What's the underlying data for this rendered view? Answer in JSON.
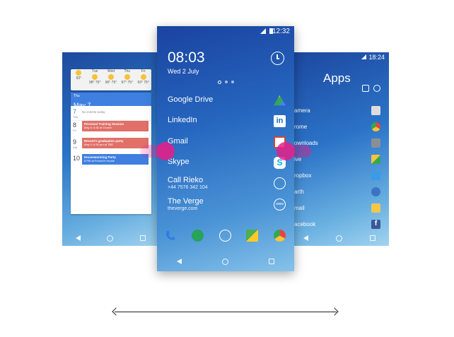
{
  "left_phone": {
    "status_time": "",
    "weather": [
      {
        "day": "",
        "temp": "93°"
      },
      {
        "day": "Tue",
        "temp": "98° 75°"
      },
      {
        "day": "Wed",
        "temp": "96° 75°"
      },
      {
        "day": "Thu",
        "temp": "97° 75°"
      },
      {
        "day": "Fri",
        "temp": "93° 75°"
      }
    ],
    "calendar": {
      "weekday": "Thu",
      "date": "May 7",
      "rows": [
        {
          "num": "7",
          "dow": "Thu",
          "note": "No events today"
        },
        {
          "num": "8",
          "dow": "Fri"
        },
        {
          "num": "9",
          "dow": "Sat"
        },
        {
          "num": "10",
          "dow": ""
        }
      ],
      "events": [
        {
          "title": "Personal Training Session",
          "detail": "May 8, 6:30 at Crunch",
          "color": "#e07068"
        },
        {
          "title": "Recent's graduation party",
          "detail": "May 9, 6:30 pm at TBD",
          "color": "#e07068"
        },
        {
          "title": "Housewarming Party",
          "detail": "8 PM at Freund's House",
          "color": "#3f7fe0"
        }
      ]
    }
  },
  "center_phone": {
    "status_time": "12:32",
    "clock": "08:03",
    "date": "Wed 2 July",
    "items": [
      {
        "title": "Google Drive",
        "sub": "",
        "icon": "google-drive-icon"
      },
      {
        "title": "LinkedIn",
        "sub": "",
        "icon": "linkedin-icon",
        "glyph": "in"
      },
      {
        "title": "Gmail",
        "sub": "",
        "icon": "gmail-icon"
      },
      {
        "title": "Skype",
        "sub": "",
        "icon": "skype-icon",
        "glyph": "S"
      },
      {
        "title": "Call Rieko",
        "sub": "+44 7576 342 104",
        "icon": "contact-icon"
      },
      {
        "title": "The Verge",
        "sub": "theverge.com",
        "icon": "www-icon",
        "glyph": "www"
      }
    ],
    "dock": [
      "phone-icon",
      "hangouts-icon",
      "app-drawer-icon",
      "maps-icon",
      "chrome-icon"
    ]
  },
  "right_phone": {
    "status_time": "18:24",
    "title": "Apps",
    "apps": [
      {
        "label": "amera",
        "icon": "camera-icon",
        "color": "#dddddd"
      },
      {
        "label": "rome",
        "icon": "chrome-icon",
        "color": "#e8453c"
      },
      {
        "label": "ownloads",
        "icon": "downloads-icon",
        "color": "#8a8f96"
      },
      {
        "label": "ive",
        "icon": "drive-icon",
        "color": "#f7c43c"
      },
      {
        "label": "ropbox",
        "icon": "dropbox-icon",
        "color": "#3d9ae8"
      },
      {
        "label": "arth",
        "icon": "earth-icon",
        "color": "#3b74c4"
      },
      {
        "label": "mail",
        "icon": "email-icon",
        "color": "#f2c84b"
      },
      {
        "label": "acebook",
        "icon": "facebook-icon",
        "color": "#3b5998"
      }
    ]
  },
  "colors": {
    "touch": "#e0218a",
    "accent": "#3f7fe0"
  }
}
